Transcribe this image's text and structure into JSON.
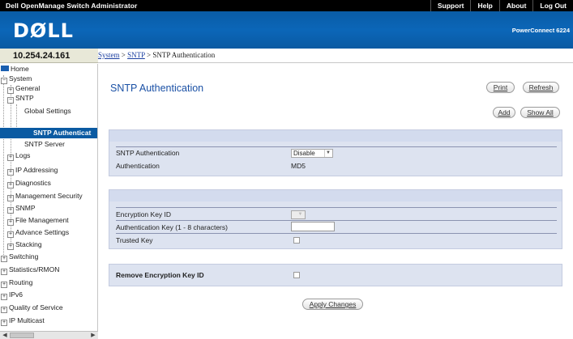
{
  "topbar": {
    "app_title": "Dell OpenManage Switch Administrator",
    "links": [
      "Support",
      "Help",
      "About",
      "Log Out"
    ]
  },
  "banner": {
    "logo": "DØLL",
    "product": "PowerConnect 6224"
  },
  "address": "10.254.24.161",
  "breadcrumb": {
    "items": [
      "System",
      "SNTP"
    ],
    "separator": " > ",
    "current": "SNTP Authentication"
  },
  "sidebar": {
    "items": [
      {
        "label": "Home",
        "icon": "folder-icon"
      },
      {
        "label": "System",
        "icon": "minus"
      },
      {
        "label": "General",
        "icon": "plus"
      },
      {
        "label": "SNTP",
        "icon": "minus"
      },
      {
        "label": "Global Settings",
        "icon": ""
      },
      {
        "label": "SNTP Authenticat",
        "icon": ""
      },
      {
        "label": "SNTP Server",
        "icon": ""
      },
      {
        "label": "Logs",
        "icon": "plus"
      },
      {
        "label": "IP Addressing",
        "icon": "plus"
      },
      {
        "label": "Diagnostics",
        "icon": "plus"
      },
      {
        "label": "Management Security",
        "icon": "plus"
      },
      {
        "label": "SNMP",
        "icon": "plus"
      },
      {
        "label": "File Management",
        "icon": "plus"
      },
      {
        "label": "Advance Settings",
        "icon": "plus"
      },
      {
        "label": "Stacking",
        "icon": "plus"
      },
      {
        "label": "Switching",
        "icon": "plus"
      },
      {
        "label": "Statistics/RMON",
        "icon": "plus"
      },
      {
        "label": "Routing",
        "icon": "plus"
      },
      {
        "label": "IPv6",
        "icon": "plus"
      },
      {
        "label": "Quality of Service",
        "icon": "plus"
      },
      {
        "label": "IP Multicast",
        "icon": "plus"
      }
    ]
  },
  "main": {
    "title": "SNTP Authentication",
    "buttons": {
      "print": "Print",
      "refresh": "Refresh",
      "add": "Add",
      "show_all": "Show All",
      "apply": "Apply Changes"
    },
    "panel1": {
      "auth_label": "SNTP Authentication",
      "auth_value": "Disable",
      "method_label": "Authentication",
      "method_value": "MD5"
    },
    "panel2": {
      "key_id_label": "Encryption Key ID",
      "key_id_value": "",
      "auth_key_label": "Authentication Key (1 - 8 characters)",
      "auth_key_value": "",
      "trusted_label": "Trusted Key"
    },
    "panel3": {
      "remove_label": "Remove Encryption Key ID"
    }
  },
  "colors": {
    "banner_blue": "#0b66b8",
    "selected_bg": "#0a5aa2",
    "panel_bg": "#dde3f0",
    "title_blue": "#1a50a5"
  }
}
